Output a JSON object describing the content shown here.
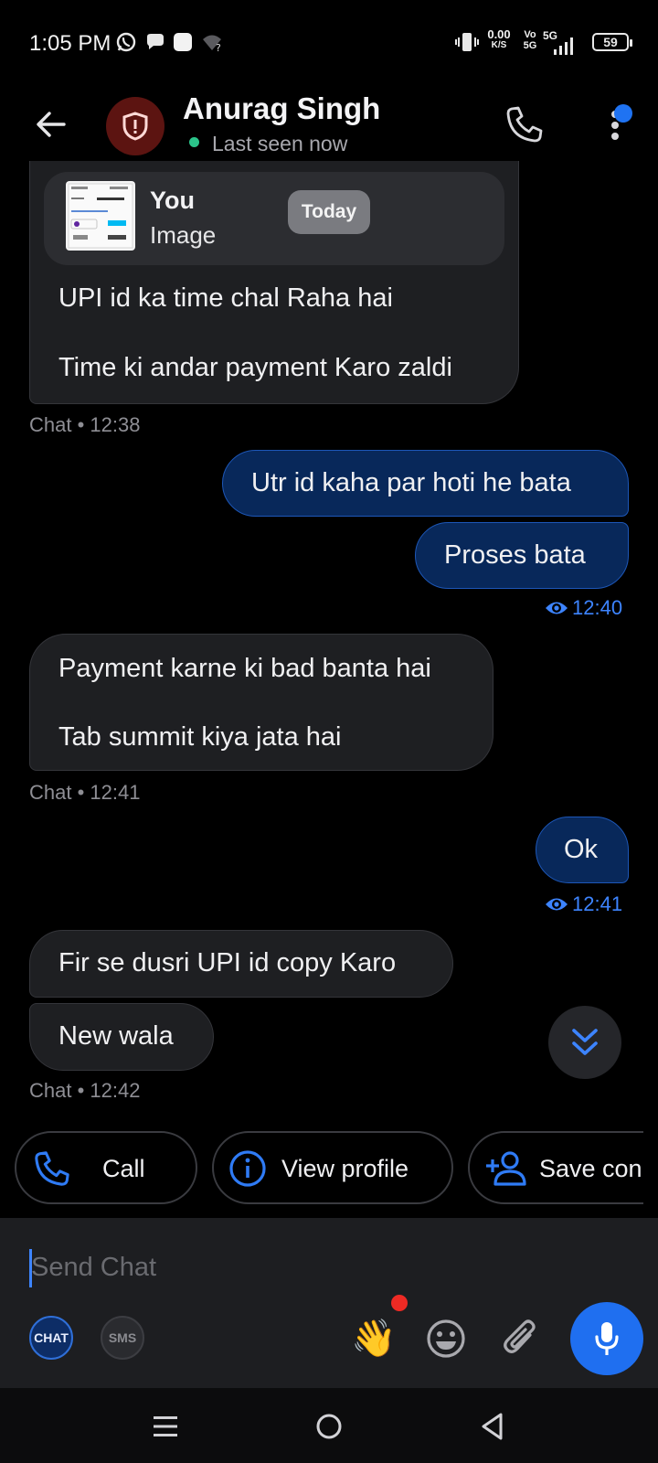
{
  "status_bar": {
    "time": "1:05 PM",
    "net_speed_value": "0.00",
    "net_speed_unit": "K/S",
    "volte_top": "Vo",
    "volte_bottom": "5G",
    "network": "5G",
    "battery": "59"
  },
  "header": {
    "contact_name": "Anurag Singh",
    "presence": "Last seen now"
  },
  "reply_preview": {
    "author": "You",
    "kind": "Image",
    "date_label": "Today"
  },
  "messages": [
    {
      "direction": "in",
      "lines": [
        "UPI id ka time chal Raha hai",
        "Time ki andar payment Karo zaldi"
      ],
      "meta": "Chat • 12:38"
    },
    {
      "direction": "out",
      "text": "Utr id kaha par hoti he bata"
    },
    {
      "direction": "out",
      "text": "Proses bata",
      "meta": "12:40"
    },
    {
      "direction": "in",
      "lines": [
        "Payment karne ki bad banta hai",
        "Tab summit kiya jata hai"
      ],
      "meta": "Chat • 12:41"
    },
    {
      "direction": "out",
      "text": "Ok",
      "meta": "12:41"
    },
    {
      "direction": "in",
      "text": "Fir se dusri UPI id copy Karo"
    },
    {
      "direction": "in",
      "text": "New wala",
      "meta": "Chat • 12:42"
    }
  ],
  "quick_actions": {
    "call": "Call",
    "view_profile": "View profile",
    "save_contact": "Save con"
  },
  "composer": {
    "placeholder": "Send Chat",
    "mode_chat": "CHAT",
    "mode_sms": "SMS",
    "wave_emoji": "👋"
  },
  "colors": {
    "accent": "#1f6ff0",
    "outgoing_bubble": "#08285a",
    "incoming_bubble": "#1e1f22",
    "presence_online": "#2bc48a",
    "notification_dot": "#ee2a24"
  }
}
